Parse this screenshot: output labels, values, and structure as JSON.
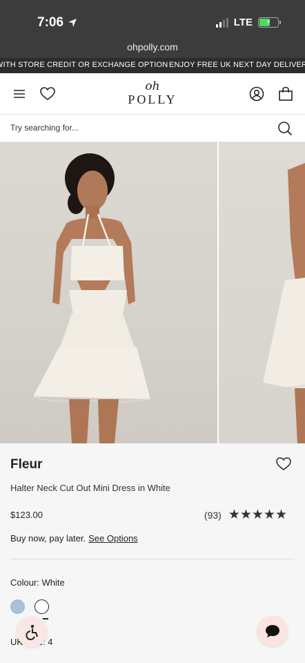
{
  "status_bar": {
    "time": "7:06",
    "network": "LTE"
  },
  "browser": {
    "url": "ohpolly.com"
  },
  "promo": {
    "left": "WITH STORE CREDIT OR EXCHANGE OPTION",
    "right": "ENJOY FREE UK NEXT DAY DELIVERY ON"
  },
  "header": {
    "logo_top": "oh",
    "logo_bottom": "POLLY"
  },
  "search": {
    "placeholder": "Try searching for..."
  },
  "product": {
    "name": "Fleur",
    "description": "Halter Neck Cut Out Mini Dress in White",
    "price": "$123.00",
    "review_count": "(93)",
    "rating": 5,
    "stars": "★★★★★",
    "bnpl_text": "Buy now, pay later.",
    "bnpl_link": "See Options",
    "colour_label": "Colour: White",
    "swatches": [
      {
        "name": "Light Blue",
        "color": "#a9c1d6"
      },
      {
        "name": "White",
        "color": "#ffffff",
        "selected": true
      }
    ],
    "size_label": "UK Size: 4"
  },
  "colors": {
    "topbar": "#3c3c3c",
    "marquee": "#2c2c2c",
    "page_bg": "#f6f6f6",
    "chat_bg": "#fde2e2"
  }
}
